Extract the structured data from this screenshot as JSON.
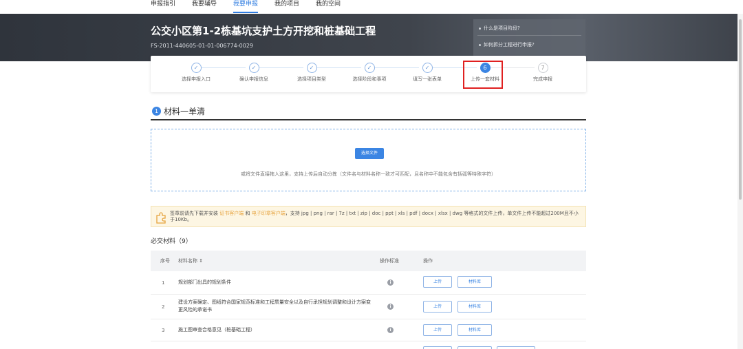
{
  "nav": {
    "items": [
      {
        "label": "申报指引",
        "active": false
      },
      {
        "label": "我要辅导",
        "active": false
      },
      {
        "label": "我要申报",
        "active": true
      },
      {
        "label": "我的项目",
        "active": false
      },
      {
        "label": "我的空间",
        "active": false
      }
    ]
  },
  "banner": {
    "title": "公交小区第1-2栋基坑支护土方开挖和桩基础工程",
    "code": "FS-2011-440605-01-01-006774-0029",
    "help": [
      "什么是项目阶段?",
      "如何拆分工程进行申报?"
    ]
  },
  "steps": [
    {
      "label": "选择申报入口",
      "state": "done",
      "mark": "✓"
    },
    {
      "label": "确认申报信息",
      "state": "done",
      "mark": "✓"
    },
    {
      "label": "选择项目类型",
      "state": "done",
      "mark": "✓"
    },
    {
      "label": "选择阶段和事项",
      "state": "done",
      "mark": "✓"
    },
    {
      "label": "填写一张表单",
      "state": "done",
      "mark": "✓"
    },
    {
      "label": "上传一套材料",
      "state": "current",
      "mark": "6"
    },
    {
      "label": "完成申报",
      "state": "todo",
      "mark": "7"
    }
  ],
  "section": {
    "number": "1",
    "title": "材料一单清"
  },
  "upload": {
    "button": "选择文件",
    "hint": "或将文件直接拖入这里，支持上传后自动分拣（文件名与材料名称一致才可匹配，且名称中不能包含有括弧等特殊字符）"
  },
  "notice": {
    "part1": "签章前请先下载并安装",
    "link1": "证书客户端",
    "and": "和",
    "link2": "电子印章客户端",
    "part2": "，支持 jpg | png | rar | 7z | txt | zip | doc | ppt | xls | pdf | docx | xlsx | dwg 等格式的文件上传，单文件上传不能超过200M且不小于10Kb。"
  },
  "required": {
    "title": "必交材料（9）",
    "headers": {
      "index": "序号",
      "name": "材料名称 ⇕",
      "standard": "操作标准",
      "action": "操作"
    },
    "upload_label": "上传",
    "library_label": "材料库",
    "rows": [
      {
        "index": "1",
        "name": "规划部门出具的规划条件"
      },
      {
        "index": "2",
        "name": "建设方案确定、图纸符合国家规范标准和工程质量安全以及自行承担规划调整和设计方案变更风险的承诺书"
      },
      {
        "index": "3",
        "name": "施工图审查合格意见（桩基础工程）"
      }
    ]
  }
}
